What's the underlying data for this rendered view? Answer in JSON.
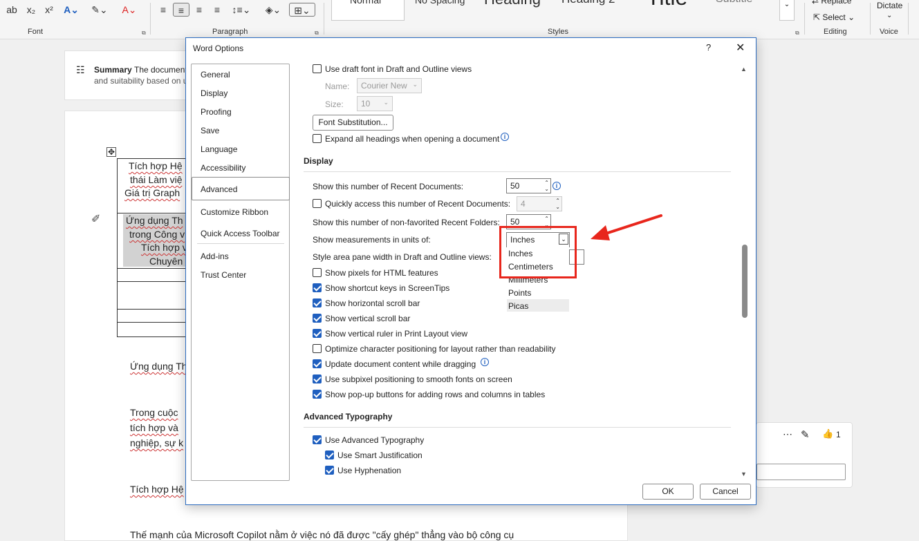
{
  "ribbon": {
    "groups": {
      "font": "Font",
      "paragraph": "Paragraph",
      "styles": "Styles",
      "editing": "Editing",
      "voice": "Voice"
    },
    "styles": [
      "Normal",
      "No Spacing",
      "Heading",
      "Heading 2",
      "Title",
      "Subtitle"
    ],
    "editing": {
      "replace": "Replace",
      "select": "Select"
    },
    "voice": {
      "dictate": "Dictate"
    }
  },
  "document": {
    "summary_title": "Summary",
    "summary_text": "The document",
    "summary_text2": "and suitability based on u",
    "table_cell1": [
      "Tích hợp Hệ",
      "thái Làm việ",
      "Giá trị Graph"
    ],
    "table_cell2": [
      "Ứng dụng Th",
      "trong Công v",
      "Tích hợp v",
      "Chuyên"
    ],
    "paragraphs": [
      "Ứng dụng Th",
      "Trong cuộc ",
      "tích hợp và",
      "nghiệp, sự k",
      "Tích hợp Hệ",
      "Thế mạnh của Microsoft Copilot nằm ở việc nó đã được \"cấy ghép\" thẳng vào bộ công cụ"
    ]
  },
  "comment": {
    "likes": "1"
  },
  "dialog": {
    "title": "Word Options",
    "help": "?",
    "close": "✕",
    "nav": [
      "General",
      "Display",
      "Proofing",
      "Save",
      "Language",
      "Accessibility",
      "Advanced",
      "Customize Ribbon",
      "Quick Access Toolbar",
      "Add-ins",
      "Trust Center"
    ],
    "top": {
      "draft_font": "Use draft font in Draft and Outline views",
      "name_label": "Name:",
      "name_value": "Courier New",
      "size_label": "Size:",
      "size_value": "10",
      "font_subst": "Font Substitution...",
      "expand_headings": "Expand all headings when opening a document"
    },
    "display": {
      "header": "Display",
      "recent_docs_label": "Show this number of Recent Documents:",
      "recent_docs_value": "50",
      "quick_access_label": "Quickly access this number of Recent Documents:",
      "quick_access_value": "4",
      "recent_folders_label": "Show this number of non-favorited Recent Folders:",
      "recent_folders_value": "50",
      "units_label": "Show measurements in units of:",
      "units_value": "Inches",
      "units_options": [
        "Inches",
        "Centimeters",
        "Millimeters",
        "Points",
        "Picas"
      ],
      "style_area_label": "Style area pane width in Draft and Outline views:",
      "checks": [
        {
          "label": "Show pixels for HTML features",
          "checked": false
        },
        {
          "label": "Show shortcut keys in ScreenTips",
          "checked": true
        },
        {
          "label": "Show horizontal scroll bar",
          "checked": true
        },
        {
          "label": "Show vertical scroll bar",
          "checked": true
        },
        {
          "label": "Show vertical ruler in Print Layout view",
          "checked": true
        },
        {
          "label": "Optimize character positioning for layout rather than readability",
          "checked": false
        },
        {
          "label": "Update document content while dragging",
          "checked": true
        },
        {
          "label": "Use subpixel positioning to smooth fonts on screen",
          "checked": true
        },
        {
          "label": "Show pop-up buttons for adding rows and columns in tables",
          "checked": true
        }
      ]
    },
    "typography": {
      "header": "Advanced Typography",
      "use_advanced": "Use Advanced Typography",
      "smart_just": "Use Smart Justification",
      "hyphenation": "Use Hyphenation"
    },
    "ok": "OK",
    "cancel": "Cancel"
  },
  "colors": {
    "accent": "#1f5fbf",
    "annotation": "#e8261c"
  }
}
